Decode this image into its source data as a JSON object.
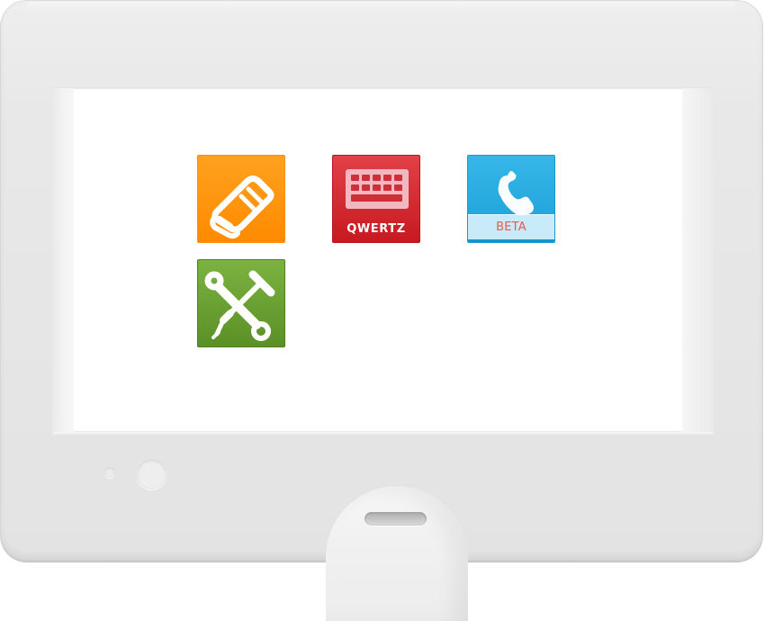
{
  "device": {
    "colors": {
      "bezel": "#e8e8e8",
      "screen": "#ffffff",
      "contacts_tile": "#ff8a00",
      "keyboard_tile": "#cf1f26",
      "phone_tile": "#1a9fd7",
      "settings_tile": "#5f962a",
      "beta_text": "#ea5a4b"
    }
  },
  "apps": {
    "contacts": {
      "icon": "address-book-icon"
    },
    "keyboard": {
      "icon": "keyboard-icon",
      "label": "QWERTZ"
    },
    "phone": {
      "icon": "phone-handset-icon",
      "label": "BETA"
    },
    "settings": {
      "icon": "wrench-screwdriver-icon"
    }
  },
  "hardware": {
    "indicator_small": "status-light-icon",
    "indicator_large": "camera-icon",
    "home_button": "home-button-icon"
  }
}
